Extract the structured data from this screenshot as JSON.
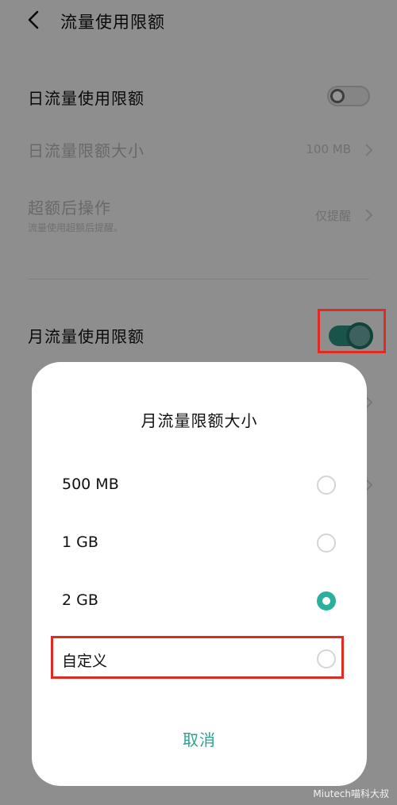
{
  "header": {
    "title": "流量使用限额",
    "back_icon": "back-arrow-icon"
  },
  "daily": {
    "limit_label": "日流量使用限额",
    "limit_enabled": false,
    "size_label": "日流量限额大小",
    "size_value": "100 MB",
    "action_label": "超额后操作",
    "action_sub": "流量使用超额后提醒。",
    "action_value": "仅提醒"
  },
  "monthly": {
    "limit_label": "月流量使用限额",
    "limit_enabled": true
  },
  "dialog": {
    "title": "月流量限额大小",
    "options": [
      {
        "label": "500 MB",
        "selected": false
      },
      {
        "label": "1 GB",
        "selected": false
      },
      {
        "label": "2 GB",
        "selected": true
      },
      {
        "label": "自定义",
        "selected": false
      }
    ],
    "cancel_label": "取消"
  },
  "colors": {
    "accent": "#2ab09b",
    "highlight": "#e02a22"
  },
  "watermark": "Miutech喵科大叔"
}
